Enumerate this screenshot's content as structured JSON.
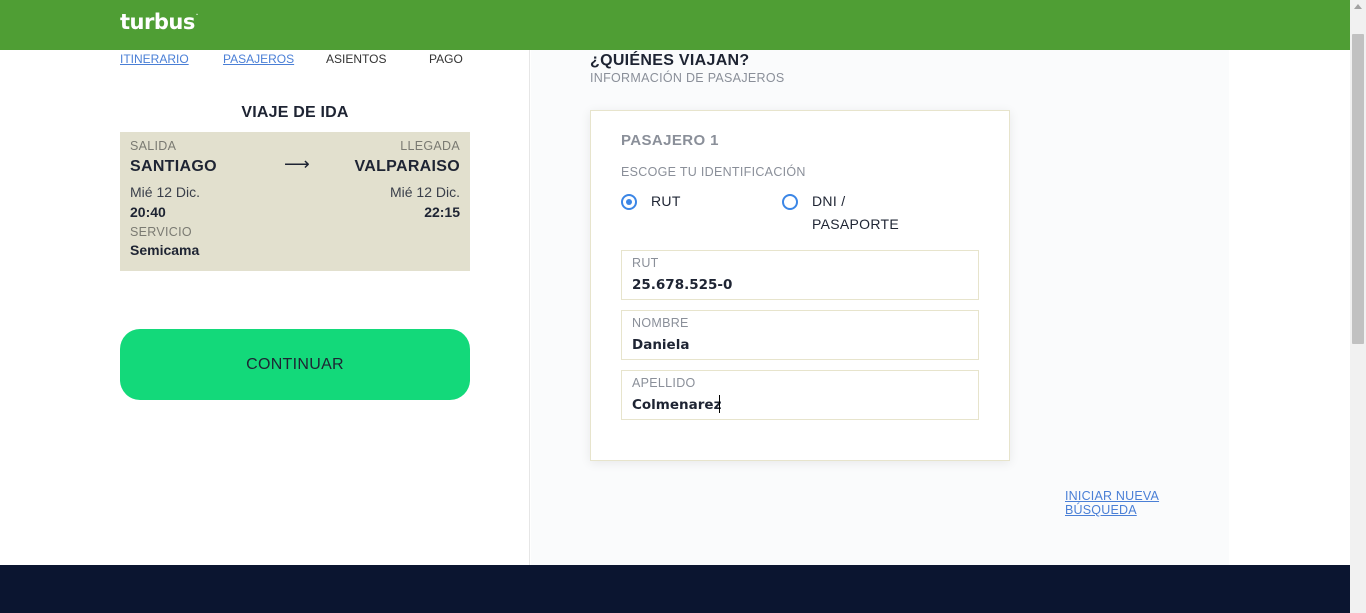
{
  "app": {
    "logo_text": "turbus",
    "logo_mark": "."
  },
  "steps": {
    "itinerario": "ITINERARIO",
    "pasajeros": "PASAJEROS",
    "asientos": "ASIENTOS",
    "pago": "PAGO"
  },
  "trip": {
    "title": "VIAJE DE IDA",
    "departure_label": "SALIDA",
    "arrival_label": "LLEGADA",
    "origin": "SANTIAGO",
    "destination": "VALPARAISO",
    "arrow": "⟶",
    "departure_date": "Mié 12 Dic.",
    "arrival_date": "Mié 12 Dic.",
    "departure_time": "20:40",
    "arrival_time": "22:15",
    "service_label": "SERVICIO",
    "service": "Semicama"
  },
  "continue_label": "CONTINUAR",
  "passengers": {
    "title": "¿QUIÉNES VIAJAN?",
    "subtitle": "INFORMACIÓN DE PASAJEROS",
    "passenger_title": "PASAJERO 1",
    "id_label": "ESCOGE TU IDENTIFICACIÓN",
    "id_options": {
      "rut": "RUT",
      "dni_line1": "DNI /",
      "dni_line2": "PASAPORTE"
    },
    "selected_id": "RUT",
    "fields": {
      "rut": {
        "label": "RUT",
        "value": "25.678.525-0"
      },
      "nombre": {
        "label": "NOMBRE",
        "value": "Daniela"
      },
      "apellido": {
        "label": "APELLIDO",
        "value": "Colmenarez"
      }
    }
  },
  "new_search_label": "INICIAR NUEVA BÚSQUEDA",
  "colors": {
    "header_green": "#4f9e34",
    "continue_green": "#13d97a",
    "trip_card_bg": "#e2e0ce",
    "link_blue": "#4a7fd6",
    "radio_blue": "#3b86e6",
    "footer_navy": "#0b1530"
  }
}
